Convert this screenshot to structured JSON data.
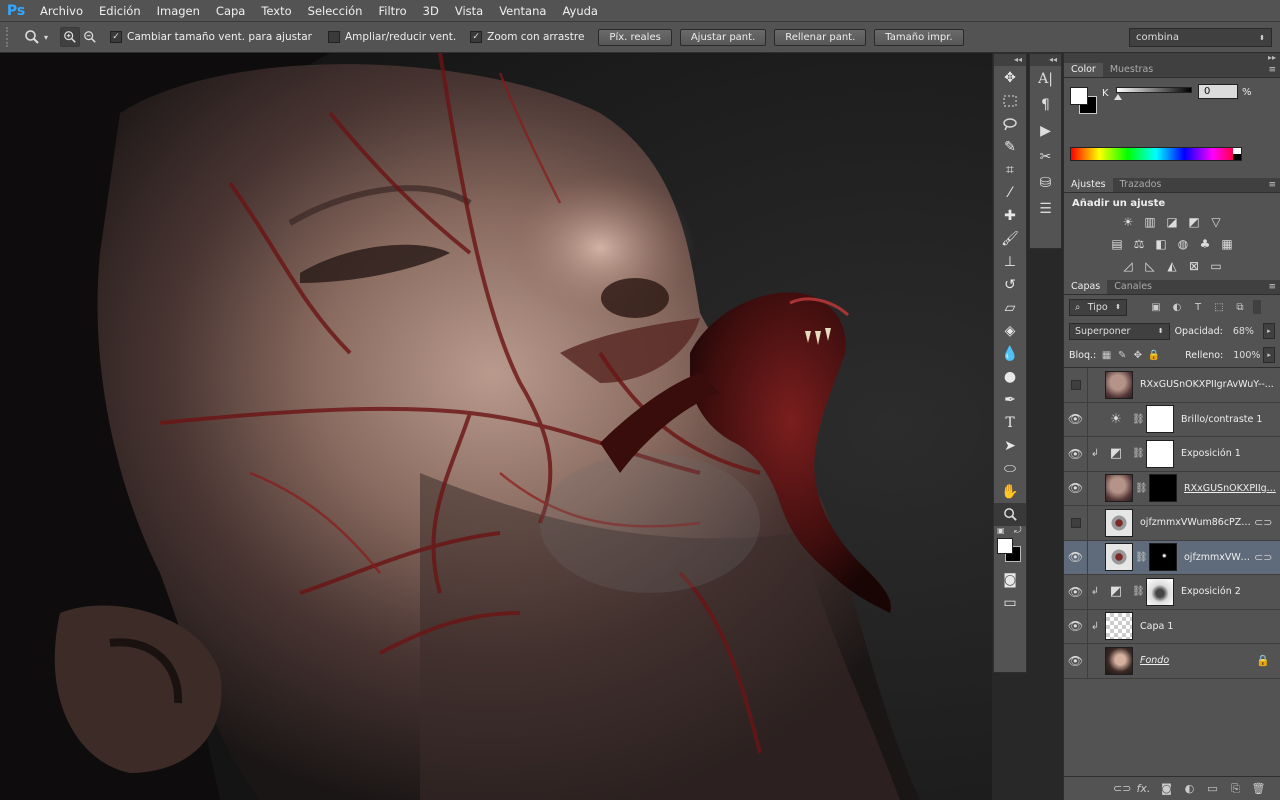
{
  "menu": [
    "Archivo",
    "Edición",
    "Imagen",
    "Capa",
    "Texto",
    "Selección",
    "Filtro",
    "3D",
    "Vista",
    "Ventana",
    "Ayuda"
  ],
  "app_logo": "Ps",
  "options": {
    "checkbox1_label": "Cambiar tamaño vent. para ajustar",
    "checkbox2_label": "Ampliar/reducir vent.",
    "checkbox3_label": "Zoom con arrastre",
    "btn_actual": "Píx. reales",
    "btn_fit": "Ajustar pant.",
    "btn_fill": "Rellenar pant.",
    "btn_print": "Tamaño impr.",
    "workspace": "combina"
  },
  "color_panel": {
    "tab_color": "Color",
    "tab_swatches": "Muestras",
    "k_label": "K",
    "k_value": "0",
    "k_unit": "%"
  },
  "adjust_panel": {
    "tab_adjust": "Ajustes",
    "tab_paths": "Trazados",
    "title": "Añadir un ajuste"
  },
  "layers_panel": {
    "tab_layers": "Capas",
    "tab_channels": "Canales",
    "filter_kind": "Tipo",
    "blend_mode": "Superponer",
    "opacity_label": "Opacidad:",
    "opacity_value": "68%",
    "lock_label": "Bloq.:",
    "fill_label": "Relleno:",
    "fill_value": "100%",
    "layers": [
      {
        "name": "RXxGUSnOKXPIIgrAvWuY--..."
      },
      {
        "name": "Brillo/contraste 1"
      },
      {
        "name": "Exposición 1"
      },
      {
        "name": "RXxGUSnOKXPIIg..."
      },
      {
        "name": "ojfzmmxVWum86cPZ39..."
      },
      {
        "name": "ojfzmmxVWu..."
      },
      {
        "name": "Exposición 2"
      },
      {
        "name": "Capa 1"
      },
      {
        "name": "Fondo"
      }
    ]
  }
}
